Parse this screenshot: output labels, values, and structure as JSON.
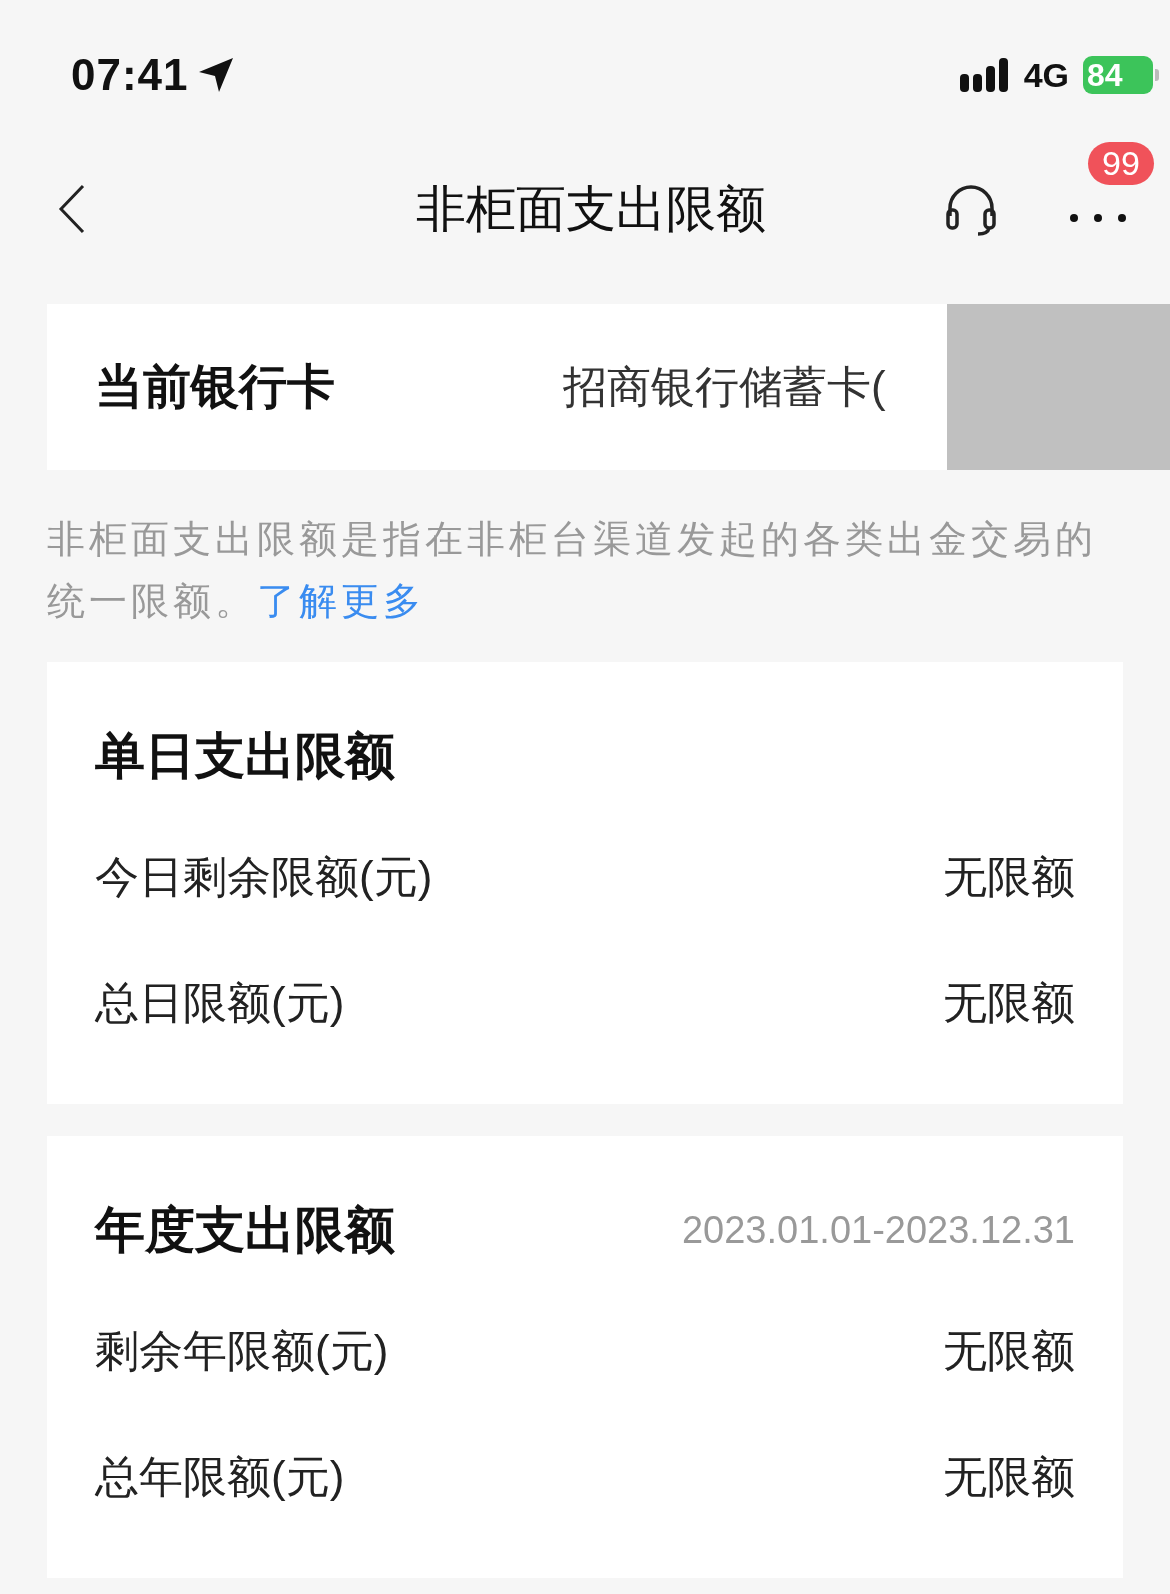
{
  "status_bar": {
    "time": "07:41",
    "network": "4G",
    "battery": "84"
  },
  "header": {
    "title": "非柜面支出限额",
    "badge": "99"
  },
  "bank_card": {
    "label": "当前银行卡",
    "value": "招商银行储蓄卡("
  },
  "description": {
    "text": "非柜面支出限额是指在非柜台渠道发起的各类出金交易的统一限额。",
    "link": "了解更多"
  },
  "sections": [
    {
      "title": "单日支出限额",
      "rows": [
        {
          "label": "今日剩余限额(元)",
          "value": "无限额"
        },
        {
          "label": "总日限额(元)",
          "value": "无限额"
        }
      ]
    },
    {
      "title": "年度支出限额",
      "period": "2023.01.01-2023.12.31",
      "rows": [
        {
          "label": "剩余年限额(元)",
          "value": "无限额"
        },
        {
          "label": "总年限额(元)",
          "value": "无限额"
        }
      ]
    }
  ]
}
